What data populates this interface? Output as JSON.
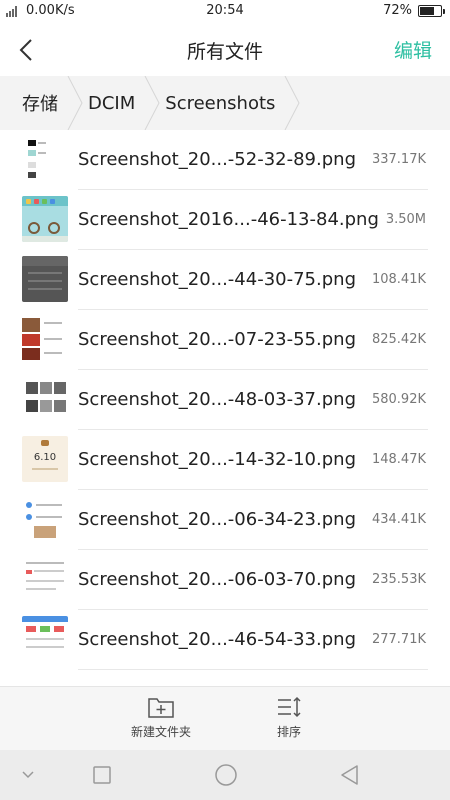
{
  "status_bar": {
    "network_speed": "0.00K/s",
    "time": "20:54",
    "battery": "72%",
    "battery_level": 0.72
  },
  "header": {
    "title": "所有文件",
    "edit_label": "编辑",
    "accent_color": "#2dbfa2"
  },
  "breadcrumb": [
    "存储",
    "DCIM",
    "Screenshots"
  ],
  "files": [
    {
      "name": "Screenshot_20...-52-32-89.png",
      "size": "337.17K"
    },
    {
      "name": "Screenshot_2016...-46-13-84.png",
      "size": "3.50M"
    },
    {
      "name": "Screenshot_20...-44-30-75.png",
      "size": "108.41K"
    },
    {
      "name": "Screenshot_20...-07-23-55.png",
      "size": "825.42K"
    },
    {
      "name": "Screenshot_20...-48-03-37.png",
      "size": "580.92K"
    },
    {
      "name": "Screenshot_20...-14-32-10.png",
      "size": "148.47K"
    },
    {
      "name": "Screenshot_20...-06-34-23.png",
      "size": "434.41K"
    },
    {
      "name": "Screenshot_20...-06-03-70.png",
      "size": "235.53K"
    },
    {
      "name": "Screenshot_20...-46-54-33.png",
      "size": "277.71K"
    }
  ],
  "toolbar": {
    "new_folder_label": "新建文件夹",
    "sort_label": "排序"
  },
  "thumb_texts": {
    "calendar_day": "6.10"
  }
}
